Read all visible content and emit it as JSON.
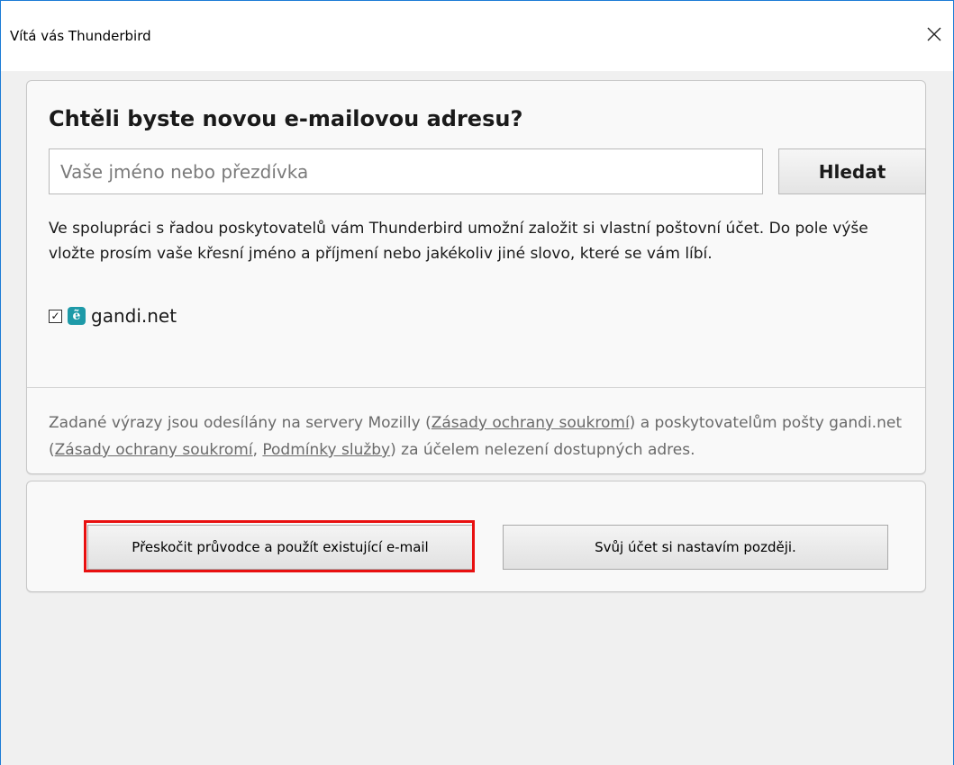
{
  "window": {
    "title": "Vítá vás Thunderbird",
    "close_icon": "close-icon"
  },
  "signup": {
    "heading": "Chtěli byste novou e-mailovou adresu?",
    "search_placeholder": "Vaše jméno nebo přezdívka",
    "search_value": "",
    "search_button": "Hledat",
    "description": "Ve spolupráci s řadou poskytovatelů vám Thunderbird umožní založit si vlastní poštovní účet. Do pole výše vložte prosím vaše křesní jméno a příjmení nebo jakékoliv jiné slovo, které se vám líbí.",
    "provider": {
      "checked": true,
      "check_glyph": "✓",
      "logo_glyph": "ẽ",
      "logo_color": "#1e9aa8",
      "name": "gandi.net"
    }
  },
  "footer": {
    "part1": "Zadané výrazy jsou odesílány na servery Mozilly (",
    "link_mozilla_privacy": "Zásady ochrany soukromí",
    "part2": ") a poskytovatelům pošty gandi.net (",
    "link_gandi_privacy": "Zásady ochrany soukromí",
    "sep": ", ",
    "link_gandi_terms": "Podmínky služby",
    "part3": ") za účelem nelezení dostupných adres."
  },
  "actions": {
    "skip_label": "Přeskočit průvodce a použít existující e-mail",
    "later_label": "Svůj účet si nastavím později.",
    "highlight_color": "#e81010"
  }
}
